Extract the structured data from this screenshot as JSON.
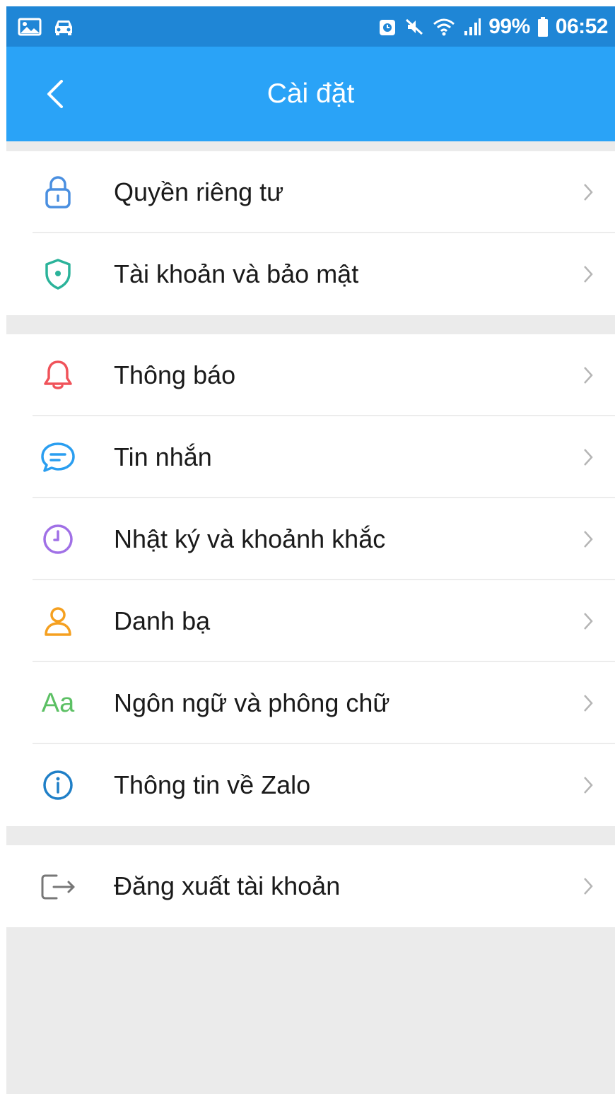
{
  "status_bar": {
    "battery": "99%",
    "time": "06:52",
    "left_icons": [
      "gallery-icon",
      "car-icon"
    ],
    "right_icons": [
      "alarm-icon",
      "mute-icon",
      "wifi-icon",
      "signal-icon",
      "battery-icon"
    ]
  },
  "app_bar": {
    "title": "Cài đặt",
    "back_icon": "back-arrow-icon"
  },
  "groups": [
    {
      "items": [
        {
          "label": "Quyền riêng tư",
          "icon": "lock-icon",
          "color": "#4a8fe0"
        },
        {
          "label": "Tài khoản và bảo mật",
          "icon": "shield-icon",
          "color": "#2bb39a"
        }
      ]
    },
    {
      "items": [
        {
          "label": "Thông báo",
          "icon": "bell-icon",
          "color": "#f0535a"
        },
        {
          "label": "Tin nhắn",
          "icon": "message-icon",
          "color": "#2a9ef0"
        },
        {
          "label": "Nhật ký và khoảnh khắc",
          "icon": "clock-icon",
          "color": "#a070e6"
        },
        {
          "label": "Danh bạ",
          "icon": "contact-icon",
          "color": "#f5a020"
        },
        {
          "label": "Ngôn ngữ và phông chữ",
          "icon": "font-icon",
          "icon_text": "Aa",
          "color": "#5cc064"
        },
        {
          "label": "Thông tin về Zalo",
          "icon": "info-icon",
          "color": "#1f7fc7"
        }
      ]
    },
    {
      "items": [
        {
          "label": "Đăng xuất tài khoản",
          "icon": "logout-icon",
          "color": "#777777"
        }
      ]
    }
  ],
  "colors": {
    "status_bar": "#1f86d6",
    "app_bar": "#2aa3f7",
    "background": "#ebebeb",
    "chevron": "#b5b5b5"
  }
}
